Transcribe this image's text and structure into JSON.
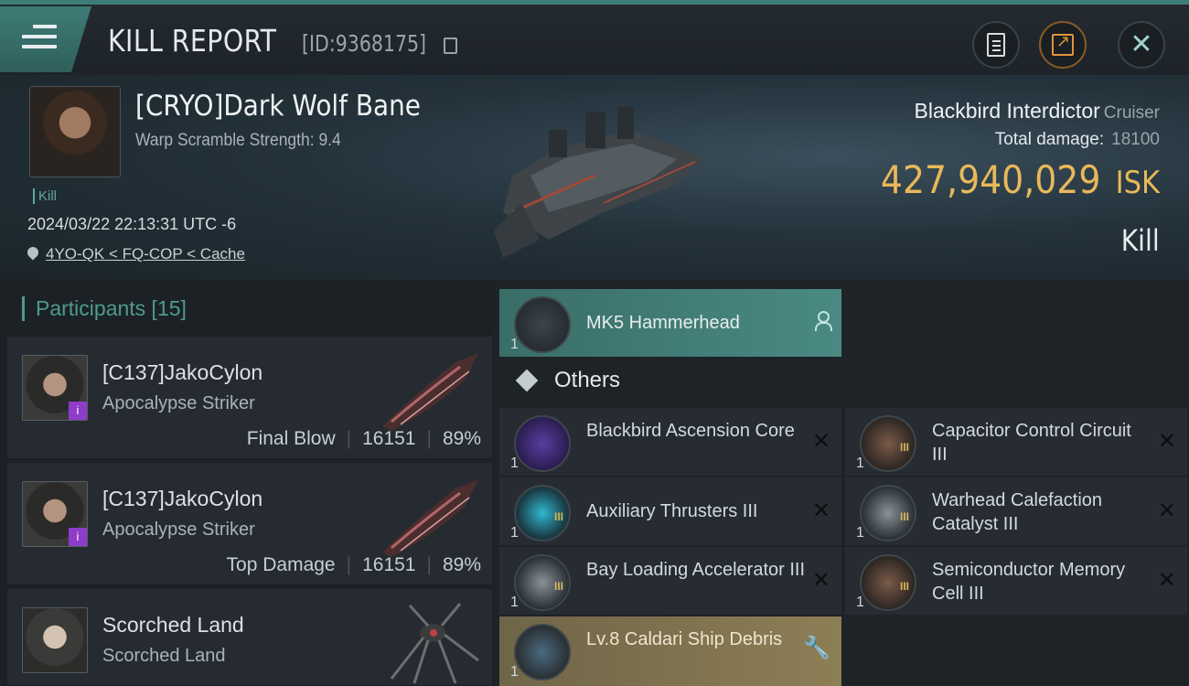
{
  "header": {
    "title": "KILL REPORT",
    "id_label": "[ID:9368175]"
  },
  "victim": {
    "name": "[CRYO]Dark Wolf Bane",
    "warp_scramble": "Warp Scramble Strength: 9.4",
    "tag": "Kill",
    "time": "2024/03/22 22:13:31 UTC -6",
    "location": "4YO-QK < FQ-COP < Cache",
    "ship_name": "Blackbird Interdictor",
    "ship_class": "Cruiser",
    "total_damage_label": "Total damage:",
    "total_damage_value": "18100",
    "isk_value": "427,940,029",
    "isk_unit": "ISK",
    "result": "Kill"
  },
  "participants": {
    "header": "Participants [15]",
    "rows": [
      {
        "name": "[C137]JakoCylon",
        "ship": "Apocalypse Striker",
        "role": "Final Blow",
        "damage": "16151",
        "percent": "89%"
      },
      {
        "name": "[C137]JakoCylon",
        "ship": "Apocalypse Striker",
        "role": "Top Damage",
        "damage": "16151",
        "percent": "89%"
      },
      {
        "name": "Scorched Land",
        "ship": "Scorched Land"
      }
    ]
  },
  "items": {
    "drone": {
      "label": "MK5  Hammerhead",
      "qty": "1"
    },
    "others_label": "Others",
    "list": [
      {
        "label": "Blackbird Ascension Core",
        "qty": "1",
        "tier": ""
      },
      {
        "label": "Capacitor Control Circuit III",
        "qty": "1",
        "tier": "III"
      },
      {
        "label": "Auxiliary Thrusters III",
        "qty": "1",
        "tier": "III"
      },
      {
        "label": "Warhead Calefaction Catalyst III",
        "qty": "1",
        "tier": "III"
      },
      {
        "label": "Bay Loading Accelerator III",
        "qty": "1",
        "tier": "III"
      },
      {
        "label": "Semiconductor Memory Cell III",
        "qty": "1",
        "tier": "III"
      }
    ],
    "debris": {
      "label": "Lv.8 Caldari Ship Debris",
      "qty": "1"
    }
  }
}
